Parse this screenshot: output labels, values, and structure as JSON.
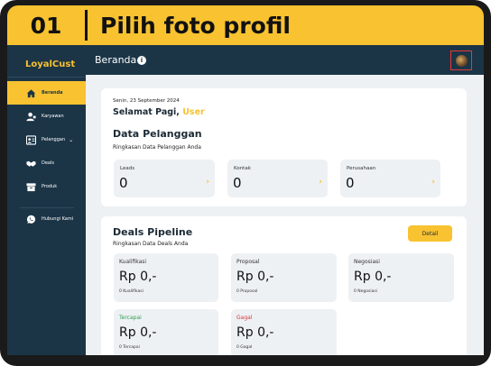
{
  "banner": {
    "step": "01",
    "title": "Pilih foto profil"
  },
  "app": {
    "logo": "LoyalCust"
  },
  "sidebar": {
    "items": [
      {
        "label": "Beranda",
        "icon": "home-icon"
      },
      {
        "label": "Karyawan",
        "icon": "employee-icon"
      },
      {
        "label": "Pelanggan",
        "icon": "customer-icon",
        "chevron": "⌄"
      },
      {
        "label": "Deals",
        "icon": "handshake-icon"
      },
      {
        "label": "Produk",
        "icon": "box-icon"
      },
      {
        "label": "Hubungi Kami",
        "icon": "whatsapp-icon"
      }
    ]
  },
  "topbar": {
    "title": "Beranda",
    "info": "i"
  },
  "welcome": {
    "date": "Senin, 23 September 2024",
    "greeting": "Selamat Pagi,",
    "user": "User"
  },
  "customers": {
    "title": "Data Pelanggan",
    "subtitle": "Ringkasan Data Pelanggan Anda",
    "stats": [
      {
        "label": "Leads",
        "value": "0",
        "arrow": "›"
      },
      {
        "label": "Kontak",
        "value": "0",
        "arrow": "›"
      },
      {
        "label": "Perusahaan",
        "value": "0",
        "arrow": "›"
      }
    ]
  },
  "pipeline": {
    "title": "Deals Pipeline",
    "subtitle": "Ringkasan Data Deals Anda",
    "detail_label": "Detail",
    "stages": [
      {
        "label": "Kualifikasi",
        "value": "Rp 0,-",
        "sub": "0 Kualifikasi"
      },
      {
        "label": "Proposal",
        "value": "Rp 0,-",
        "sub": "0 Proposal"
      },
      {
        "label": "Negosiasi",
        "value": "Rp 0,-",
        "sub": "0 Negosiasi"
      },
      {
        "label": "Tercapai",
        "value": "Rp 0,-",
        "sub": "0 Tercapai"
      },
      {
        "label": "Gagal",
        "value": "Rp 0,-",
        "sub": "0 Gagal"
      }
    ]
  },
  "colors": {
    "accent": "#F8C230",
    "sidebar": "#1b3547",
    "success": "#2e9e4f",
    "danger": "#d93636"
  }
}
